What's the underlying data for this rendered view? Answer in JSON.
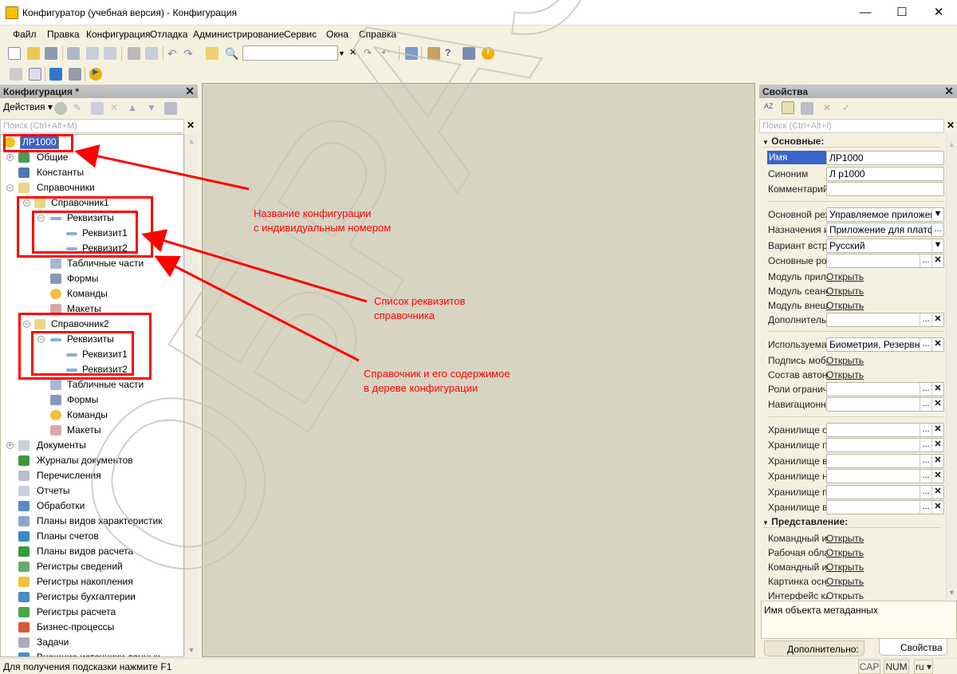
{
  "window": {
    "title": "Конфигуратор (учебная версия) - Конфигурация",
    "minimize": "—",
    "maximize": "☐",
    "close": "✕"
  },
  "menu": [
    "Файл",
    "Правка",
    "Конфигурация",
    "Отладка",
    "Администрирование",
    "Сервис",
    "Окна",
    "Справка"
  ],
  "toolbar": {
    "search_value": ""
  },
  "left_panel": {
    "title": "Конфигурация *",
    "actions": "Действия",
    "search_placeholder": "Поиск (Ctrl+Alt+M)",
    "tree": [
      {
        "label": "ЛР1000",
        "level": 0,
        "selected": true,
        "icon": "config-icon"
      },
      {
        "label": "Общие",
        "level": 1,
        "expander": "+",
        "icon": "common-icon"
      },
      {
        "label": "Константы",
        "level": 1,
        "icon": "constants-icon"
      },
      {
        "label": "Справочники",
        "level": 1,
        "expander": "−",
        "icon": "catalog-icon"
      },
      {
        "label": "Справочник1",
        "level": 2,
        "expander": "−",
        "icon": "catalog-icon"
      },
      {
        "label": "Реквизиты",
        "level": 3,
        "expander": "−",
        "icon": "attribute-icon"
      },
      {
        "label": "Реквизит1",
        "level": 4,
        "icon": "attribute-icon"
      },
      {
        "label": "Реквизит2",
        "level": 4,
        "icon": "attribute-icon"
      },
      {
        "label": "Табличные части",
        "level": 3,
        "icon": "table-icon"
      },
      {
        "label": "Формы",
        "level": 3,
        "icon": "form-icon"
      },
      {
        "label": "Команды",
        "level": 3,
        "icon": "command-icon"
      },
      {
        "label": "Макеты",
        "level": 3,
        "icon": "template-icon"
      },
      {
        "label": "Справочник2",
        "level": 2,
        "expander": "−",
        "icon": "catalog-icon"
      },
      {
        "label": "Реквизиты",
        "level": 3,
        "expander": "−",
        "icon": "attribute-icon"
      },
      {
        "label": "Реквизит1",
        "level": 4,
        "icon": "attribute-icon"
      },
      {
        "label": "Реквизит2",
        "level": 4,
        "icon": "attribute-icon"
      },
      {
        "label": "Табличные части",
        "level": 3,
        "icon": "table-icon"
      },
      {
        "label": "Формы",
        "level": 3,
        "icon": "form-icon"
      },
      {
        "label": "Команды",
        "level": 3,
        "icon": "command-icon"
      },
      {
        "label": "Макеты",
        "level": 3,
        "icon": "template-icon"
      },
      {
        "label": "Документы",
        "level": 1,
        "expander": "+",
        "icon": "document-icon"
      },
      {
        "label": "Журналы документов",
        "level": 1,
        "icon": "journal-icon"
      },
      {
        "label": "Перечисления",
        "level": 1,
        "icon": "enum-icon"
      },
      {
        "label": "Отчеты",
        "level": 1,
        "icon": "report-icon"
      },
      {
        "label": "Обработки",
        "level": 1,
        "icon": "processing-icon"
      },
      {
        "label": "Планы видов характеристик",
        "level": 1,
        "icon": "chart-of-characteristics-icon"
      },
      {
        "label": "Планы счетов",
        "level": 1,
        "icon": "chart-of-accounts-icon"
      },
      {
        "label": "Планы видов расчета",
        "level": 1,
        "icon": "chart-of-calc-icon"
      },
      {
        "label": "Регистры сведений",
        "level": 1,
        "icon": "info-register-icon"
      },
      {
        "label": "Регистры накопления",
        "level": 1,
        "icon": "accum-register-icon"
      },
      {
        "label": "Регистры бухгалтерии",
        "level": 1,
        "icon": "accounting-register-icon"
      },
      {
        "label": "Регистры расчета",
        "level": 1,
        "icon": "calc-register-icon"
      },
      {
        "label": "Бизнес-процессы",
        "level": 1,
        "icon": "business-process-icon"
      },
      {
        "label": "Задачи",
        "level": 1,
        "icon": "task-icon"
      },
      {
        "label": "Внешние источники данных",
        "level": 1,
        "icon": "external-source-icon"
      }
    ]
  },
  "properties": {
    "title": "Свойства",
    "search_placeholder": "Поиск (Ctrl+Alt+I)",
    "rows": [
      {
        "type": "section",
        "label": "Основные:"
      },
      {
        "type": "field",
        "label": "Имя",
        "value": "ЛР1000",
        "selected": true
      },
      {
        "type": "field",
        "label": "Синоним",
        "value": "Л р1000"
      },
      {
        "type": "field",
        "label": "Комментарий",
        "value": ""
      },
      {
        "type": "sep"
      },
      {
        "type": "field",
        "label": "Основной режим запуска",
        "value": "Управляемое приложение",
        "btn": "▼"
      },
      {
        "type": "field",
        "label": "Назначения использования",
        "value": "Приложение для платформы",
        "btn": "..."
      },
      {
        "type": "field",
        "label": "Вариант встроенного языка",
        "value": "Русский",
        "btn": "▼"
      },
      {
        "type": "field",
        "label": "Основные роли",
        "value": "",
        "btn": "...",
        "clear": true
      },
      {
        "type": "link",
        "label": "Модуль приложения",
        "value": "Открыть"
      },
      {
        "type": "link",
        "label": "Модуль сеанса",
        "value": "Открыть"
      },
      {
        "type": "link",
        "label": "Модуль внешнего соединения",
        "value": "Открыть"
      },
      {
        "type": "field",
        "label": "Дополнительные",
        "value": "",
        "btn": "...",
        "clear": true
      },
      {
        "type": "sep"
      },
      {
        "type": "field",
        "label": "Используемая функциональность",
        "value": "Биометрия, Резервное",
        "btn": "...",
        "clear": true
      },
      {
        "type": "link",
        "label": "Подпись мобильного",
        "value": "Открыть"
      },
      {
        "type": "link",
        "label": "Состав автономной",
        "value": "Открыть"
      },
      {
        "type": "field",
        "label": "Роли ограничения",
        "value": "",
        "btn": "...",
        "clear": true
      },
      {
        "type": "field",
        "label": "Навигационные",
        "value": "",
        "btn": "...",
        "clear": true
      },
      {
        "type": "sep"
      },
      {
        "type": "field",
        "label": "Хранилище общих",
        "value": "",
        "btn": "...",
        "clear": true
      },
      {
        "type": "field",
        "label": "Хранилище пользовательских",
        "value": "",
        "btn": "...",
        "clear": true
      },
      {
        "type": "field",
        "label": "Хранилище вариантов",
        "value": "",
        "btn": "...",
        "clear": true
      },
      {
        "type": "field",
        "label": "Хранилище настроек",
        "value": "",
        "btn": "...",
        "clear": true
      },
      {
        "type": "field",
        "label": "Хранилище пользовательских",
        "value": "",
        "btn": "...",
        "clear": true
      },
      {
        "type": "field",
        "label": "Хранилище внешних",
        "value": "",
        "btn": "...",
        "clear": true
      },
      {
        "type": "section",
        "label": "Представление:"
      },
      {
        "type": "link",
        "label": "Командный интерфейс",
        "value": "Открыть"
      },
      {
        "type": "link",
        "label": "Рабочая область",
        "value": "Открыть"
      },
      {
        "type": "link",
        "label": "Командный интерфейс",
        "value": "Открыть"
      },
      {
        "type": "link",
        "label": "Картинка основного",
        "value": "Открыть"
      },
      {
        "type": "link",
        "label": "Интерфейс клиентского",
        "value": "Открыть"
      }
    ],
    "description": "Имя объекта метаданных",
    "tabs": [
      {
        "label": "Дополнительно: ..."
      },
      {
        "label": "Свойства",
        "active": true
      }
    ]
  },
  "annotations": [
    "Название конфигурации\nс индивидуальным номером",
    "Список реквизитов\nсправочника",
    "Справочник и его содержимое\nв дереве конфигурации"
  ],
  "watermark": "ОБРАЗЕЦ",
  "status": {
    "hint": "Для получения подсказки нажмите F1",
    "cap": "CAP",
    "num": "NUM",
    "lang": "ru ▾"
  },
  "colors": {
    "annotation": "#ff0000",
    "selection": "#3a64c8",
    "workspace": "#d8d4c2"
  }
}
